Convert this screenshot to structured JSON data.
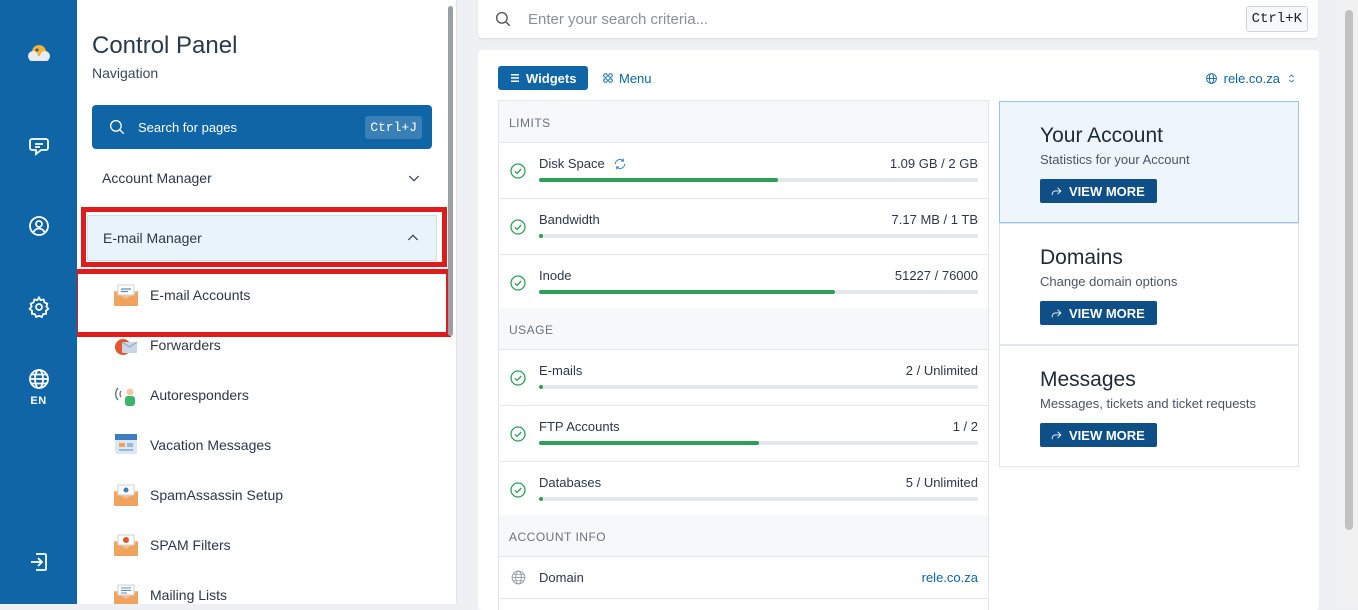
{
  "rail": {
    "items": [
      {
        "name": "brand-logo-icon"
      },
      {
        "name": "messages-icon"
      },
      {
        "name": "profile-icon"
      },
      {
        "name": "settings-icon"
      },
      {
        "name": "language-icon",
        "label": "EN"
      },
      {
        "name": "logout-icon"
      }
    ]
  },
  "nav": {
    "title": "Control Panel",
    "subtitle": "Navigation",
    "search_label": "Search for pages",
    "search_shortcut": "Ctrl+J",
    "sections": [
      {
        "label": "Account Manager",
        "expanded": false
      },
      {
        "label": "E-mail Manager",
        "expanded": true
      }
    ],
    "items": [
      {
        "label": "E-mail Accounts"
      },
      {
        "label": "Forwarders"
      },
      {
        "label": "Autoresponders"
      },
      {
        "label": "Vacation Messages"
      },
      {
        "label": "SpamAssassin Setup"
      },
      {
        "label": "SPAM Filters"
      },
      {
        "label": "Mailing Lists"
      }
    ]
  },
  "topsearch": {
    "placeholder": "Enter your search criteria...",
    "shortcut": "Ctrl+K"
  },
  "main": {
    "tabs": {
      "widgets": "Widgets",
      "menu": "Menu"
    },
    "domain": "rele.co.za",
    "groups": {
      "limits": "LIMITS",
      "usage": "USAGE",
      "account_info": "ACCOUNT INFO"
    },
    "limits": [
      {
        "name": "Disk Space",
        "value": "1.09 GB / 2 GB",
        "percent": 54.5
      },
      {
        "name": "Bandwidth",
        "value": "7.17 MB / 1 TB",
        "percent": 1
      },
      {
        "name": "Inode",
        "value": "51227 / 76000",
        "percent": 67.4
      }
    ],
    "usage": [
      {
        "name": "E-mails",
        "value": "2 / Unlimited",
        "percent": 1
      },
      {
        "name": "FTP Accounts",
        "value": "1 / 2",
        "percent": 50
      },
      {
        "name": "Databases",
        "value": "5 / Unlimited",
        "percent": 1
      }
    ],
    "account_info": [
      {
        "name": "Domain",
        "value": "rele.co.za"
      }
    ],
    "cards": [
      {
        "title": "Your Account",
        "desc": "Statistics for your Account",
        "button": "VIEW MORE"
      },
      {
        "title": "Domains",
        "desc": "Change domain options",
        "button": "VIEW MORE"
      },
      {
        "title": "Messages",
        "desc": "Messages, tickets and ticket requests",
        "button": "VIEW MORE"
      }
    ]
  },
  "colors": {
    "primary": "#0f65a6",
    "progress": "#2e9e5b",
    "highlight": "#e01b1b"
  }
}
